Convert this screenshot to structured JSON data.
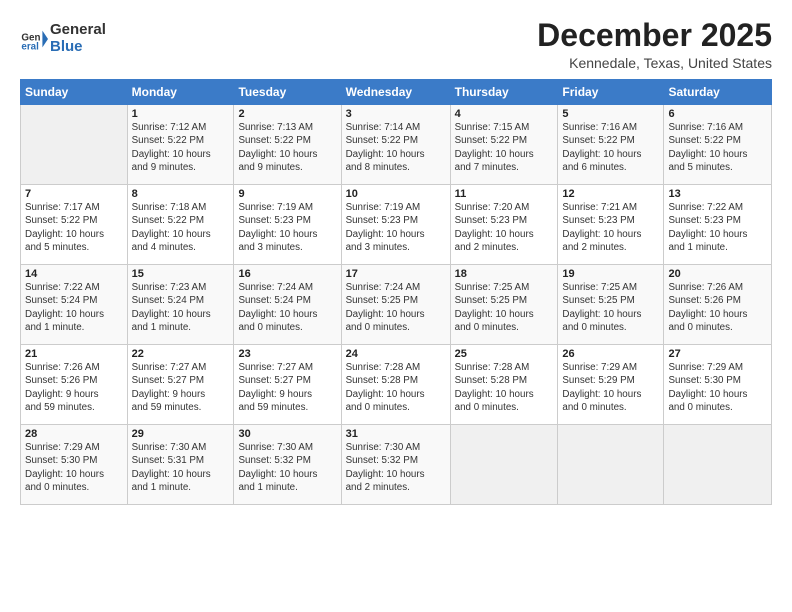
{
  "header": {
    "logo": {
      "general": "General",
      "blue": "Blue"
    },
    "title": "December 2025",
    "subtitle": "Kennedale, Texas, United States"
  },
  "calendar": {
    "weekdays": [
      "Sunday",
      "Monday",
      "Tuesday",
      "Wednesday",
      "Thursday",
      "Friday",
      "Saturday"
    ],
    "weeks": [
      [
        {
          "day": "",
          "info": ""
        },
        {
          "day": "1",
          "info": "Sunrise: 7:12 AM\nSunset: 5:22 PM\nDaylight: 10 hours\nand 9 minutes."
        },
        {
          "day": "2",
          "info": "Sunrise: 7:13 AM\nSunset: 5:22 PM\nDaylight: 10 hours\nand 9 minutes."
        },
        {
          "day": "3",
          "info": "Sunrise: 7:14 AM\nSunset: 5:22 PM\nDaylight: 10 hours\nand 8 minutes."
        },
        {
          "day": "4",
          "info": "Sunrise: 7:15 AM\nSunset: 5:22 PM\nDaylight: 10 hours\nand 7 minutes."
        },
        {
          "day": "5",
          "info": "Sunrise: 7:16 AM\nSunset: 5:22 PM\nDaylight: 10 hours\nand 6 minutes."
        },
        {
          "day": "6",
          "info": "Sunrise: 7:16 AM\nSunset: 5:22 PM\nDaylight: 10 hours\nand 5 minutes."
        }
      ],
      [
        {
          "day": "7",
          "info": "Sunrise: 7:17 AM\nSunset: 5:22 PM\nDaylight: 10 hours\nand 5 minutes."
        },
        {
          "day": "8",
          "info": "Sunrise: 7:18 AM\nSunset: 5:22 PM\nDaylight: 10 hours\nand 4 minutes."
        },
        {
          "day": "9",
          "info": "Sunrise: 7:19 AM\nSunset: 5:23 PM\nDaylight: 10 hours\nand 3 minutes."
        },
        {
          "day": "10",
          "info": "Sunrise: 7:19 AM\nSunset: 5:23 PM\nDaylight: 10 hours\nand 3 minutes."
        },
        {
          "day": "11",
          "info": "Sunrise: 7:20 AM\nSunset: 5:23 PM\nDaylight: 10 hours\nand 2 minutes."
        },
        {
          "day": "12",
          "info": "Sunrise: 7:21 AM\nSunset: 5:23 PM\nDaylight: 10 hours\nand 2 minutes."
        },
        {
          "day": "13",
          "info": "Sunrise: 7:22 AM\nSunset: 5:23 PM\nDaylight: 10 hours\nand 1 minute."
        }
      ],
      [
        {
          "day": "14",
          "info": "Sunrise: 7:22 AM\nSunset: 5:24 PM\nDaylight: 10 hours\nand 1 minute."
        },
        {
          "day": "15",
          "info": "Sunrise: 7:23 AM\nSunset: 5:24 PM\nDaylight: 10 hours\nand 1 minute."
        },
        {
          "day": "16",
          "info": "Sunrise: 7:24 AM\nSunset: 5:24 PM\nDaylight: 10 hours\nand 0 minutes."
        },
        {
          "day": "17",
          "info": "Sunrise: 7:24 AM\nSunset: 5:25 PM\nDaylight: 10 hours\nand 0 minutes."
        },
        {
          "day": "18",
          "info": "Sunrise: 7:25 AM\nSunset: 5:25 PM\nDaylight: 10 hours\nand 0 minutes."
        },
        {
          "day": "19",
          "info": "Sunrise: 7:25 AM\nSunset: 5:25 PM\nDaylight: 10 hours\nand 0 minutes."
        },
        {
          "day": "20",
          "info": "Sunrise: 7:26 AM\nSunset: 5:26 PM\nDaylight: 10 hours\nand 0 minutes."
        }
      ],
      [
        {
          "day": "21",
          "info": "Sunrise: 7:26 AM\nSunset: 5:26 PM\nDaylight: 9 hours\nand 59 minutes."
        },
        {
          "day": "22",
          "info": "Sunrise: 7:27 AM\nSunset: 5:27 PM\nDaylight: 9 hours\nand 59 minutes."
        },
        {
          "day": "23",
          "info": "Sunrise: 7:27 AM\nSunset: 5:27 PM\nDaylight: 9 hours\nand 59 minutes."
        },
        {
          "day": "24",
          "info": "Sunrise: 7:28 AM\nSunset: 5:28 PM\nDaylight: 10 hours\nand 0 minutes."
        },
        {
          "day": "25",
          "info": "Sunrise: 7:28 AM\nSunset: 5:28 PM\nDaylight: 10 hours\nand 0 minutes."
        },
        {
          "day": "26",
          "info": "Sunrise: 7:29 AM\nSunset: 5:29 PM\nDaylight: 10 hours\nand 0 minutes."
        },
        {
          "day": "27",
          "info": "Sunrise: 7:29 AM\nSunset: 5:30 PM\nDaylight: 10 hours\nand 0 minutes."
        }
      ],
      [
        {
          "day": "28",
          "info": "Sunrise: 7:29 AM\nSunset: 5:30 PM\nDaylight: 10 hours\nand 0 minutes."
        },
        {
          "day": "29",
          "info": "Sunrise: 7:30 AM\nSunset: 5:31 PM\nDaylight: 10 hours\nand 1 minute."
        },
        {
          "day": "30",
          "info": "Sunrise: 7:30 AM\nSunset: 5:32 PM\nDaylight: 10 hours\nand 1 minute."
        },
        {
          "day": "31",
          "info": "Sunrise: 7:30 AM\nSunset: 5:32 PM\nDaylight: 10 hours\nand 2 minutes."
        },
        {
          "day": "",
          "info": ""
        },
        {
          "day": "",
          "info": ""
        },
        {
          "day": "",
          "info": ""
        }
      ]
    ]
  }
}
